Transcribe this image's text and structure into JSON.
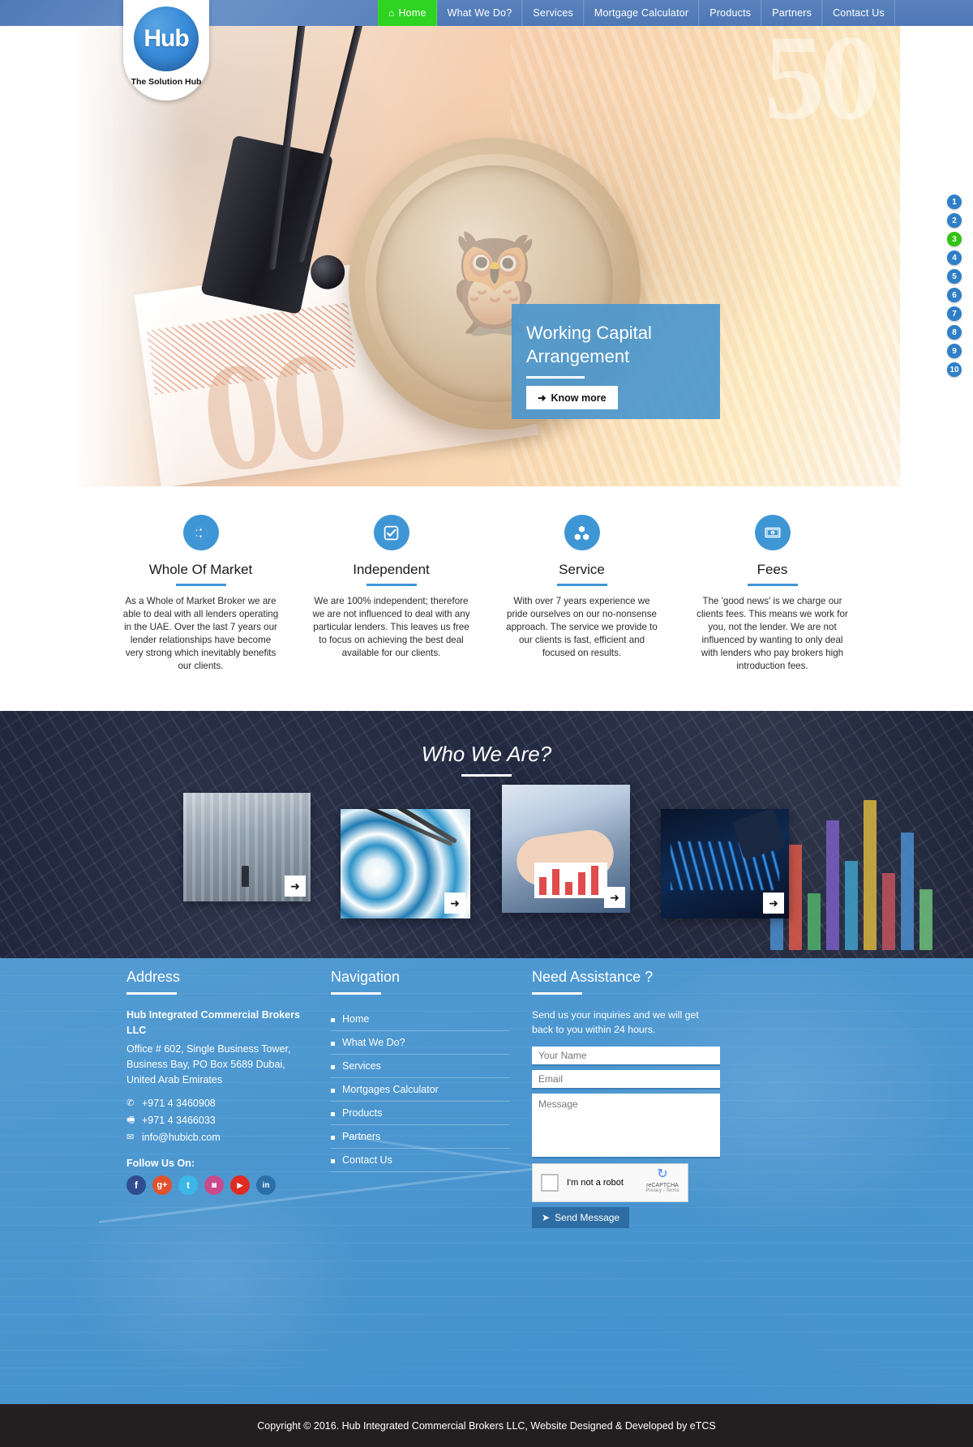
{
  "brand": {
    "logo_text": "Hub",
    "logo_tagline": "The Solution Hub"
  },
  "nav": {
    "items": [
      {
        "label": "Home",
        "icon": "home-icon",
        "active": true
      },
      {
        "label": "What We Do?",
        "active": false
      },
      {
        "label": "Services",
        "active": false
      },
      {
        "label": "Mortgage Calculator",
        "active": false
      },
      {
        "label": "Products",
        "active": false
      },
      {
        "label": "Partners",
        "active": false
      },
      {
        "label": "Contact Us",
        "active": false
      }
    ]
  },
  "hero": {
    "caption_title_line1": "Working Capital",
    "caption_title_line2": "Arrangement",
    "button_label": "Know more",
    "button_icon": "arrow-right-icon",
    "slide_numbers": [
      "1",
      "2",
      "3",
      "4",
      "5",
      "6",
      "7",
      "8",
      "9",
      "10"
    ],
    "active_slide": "3",
    "accent_color": "#4e98cd",
    "active_dot_color": "#2fc40f",
    "dot_color": "#2f7fc8"
  },
  "features": [
    {
      "icon": "globe-icon",
      "title": "Whole Of Market",
      "text": "As a Whole of Market Broker we are able to deal with all lenders operating in the UAE. Over the last 7 years our lender relationships have become very strong which inevitably benefits our clients."
    },
    {
      "icon": "check-square-icon",
      "title": "Independent",
      "text": "We are 100% independent; therefore we are not influenced to deal with any particular lenders. This leaves us free to focus on achieving the best deal available for our clients."
    },
    {
      "icon": "cubes-icon",
      "title": "Service",
      "text": "With over 7 years experience we pride ourselves on our no-nonsense approach. The service we provide to our clients is fast, efficient and focused on results."
    },
    {
      "icon": "money-icon",
      "title": "Fees",
      "text": "The 'good news' is we charge our clients fees. This means we work for you, not the lender. We are not influenced by wanting to only deal with lenders who pay brokers high introduction fees."
    }
  ],
  "who_we_are": {
    "heading": "Who We Are?",
    "cards": [
      {
        "name": "businessman-cityscape",
        "arrow": "arrow-right-icon"
      },
      {
        "name": "target-darts",
        "arrow": "arrow-right-icon"
      },
      {
        "name": "team-meeting-charts",
        "arrow": "arrow-right-icon"
      },
      {
        "name": "growth-graph-businessman",
        "arrow": "arrow-right-icon"
      }
    ]
  },
  "footer": {
    "address": {
      "heading": "Address",
      "company": "Hub Integrated Commercial Brokers LLC",
      "street": "Office # 602, Single Business Tower, Business Bay, PO Box 5689 Dubai, United Arab Emirates",
      "phone": "+971 4 3460908",
      "fax": "+971 4 3466033",
      "email": "info@hubicb.com",
      "follow_label": "Follow Us On:",
      "socials": [
        {
          "name": "facebook",
          "glyph": "f",
          "color": "#2f4d8f"
        },
        {
          "name": "google-plus",
          "glyph": "g+",
          "color": "#e0522c"
        },
        {
          "name": "twitter",
          "glyph": "t",
          "color": "#3bb7e8"
        },
        {
          "name": "instagram",
          "glyph": "◙",
          "color": "#c84b8e"
        },
        {
          "name": "youtube",
          "glyph": "▶",
          "color": "#e02b20"
        },
        {
          "name": "linkedin",
          "glyph": "in",
          "color": "#2a6fa8"
        }
      ]
    },
    "navigation": {
      "heading": "Navigation",
      "items": [
        "Home",
        "What We Do?",
        "Services",
        "Mortgages Calculator",
        "Products",
        "Partners",
        "Contact Us"
      ]
    },
    "assistance": {
      "heading": "Need Assistance ?",
      "subtitle": "Send us your inquiries and we will get back to you within 24 hours.",
      "name_placeholder": "Your Name",
      "name_value": "",
      "email_placeholder": "Email",
      "email_value": "",
      "message_placeholder": "Message",
      "message_value": "",
      "captcha_label": "I'm not a robot",
      "captcha_brand": "reCAPTCHA",
      "captcha_terms": "Privacy - Terms",
      "send_label": "Send Message",
      "send_icon": "paper-plane-icon"
    }
  },
  "copyright": {
    "text": "Copyright © 2016. Hub Integrated Commercial Brokers LLC, Website Designed & Developed by eTCS"
  }
}
